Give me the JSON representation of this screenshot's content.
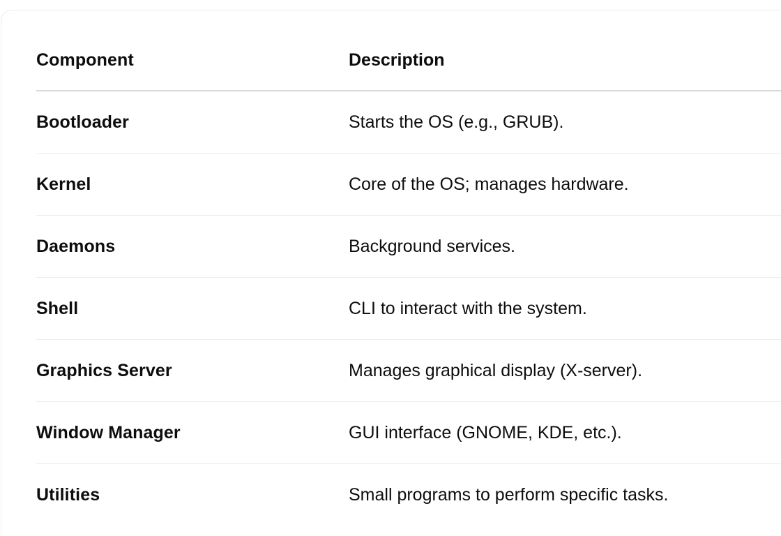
{
  "table": {
    "columns": [
      "Component",
      "Description"
    ],
    "rows": [
      [
        "Bootloader",
        "Starts the OS (e.g., GRUB)."
      ],
      [
        "Kernel",
        "Core of the OS; manages hardware."
      ],
      [
        "Daemons",
        "Background services."
      ],
      [
        "Shell",
        "CLI to interact with the system."
      ],
      [
        "Graphics Server",
        "Manages graphical display (X-server)."
      ],
      [
        "Window Manager",
        "GUI interface (GNOME, KDE, etc.)."
      ],
      [
        "Utilities",
        "Small programs to perform specific tasks."
      ]
    ]
  }
}
